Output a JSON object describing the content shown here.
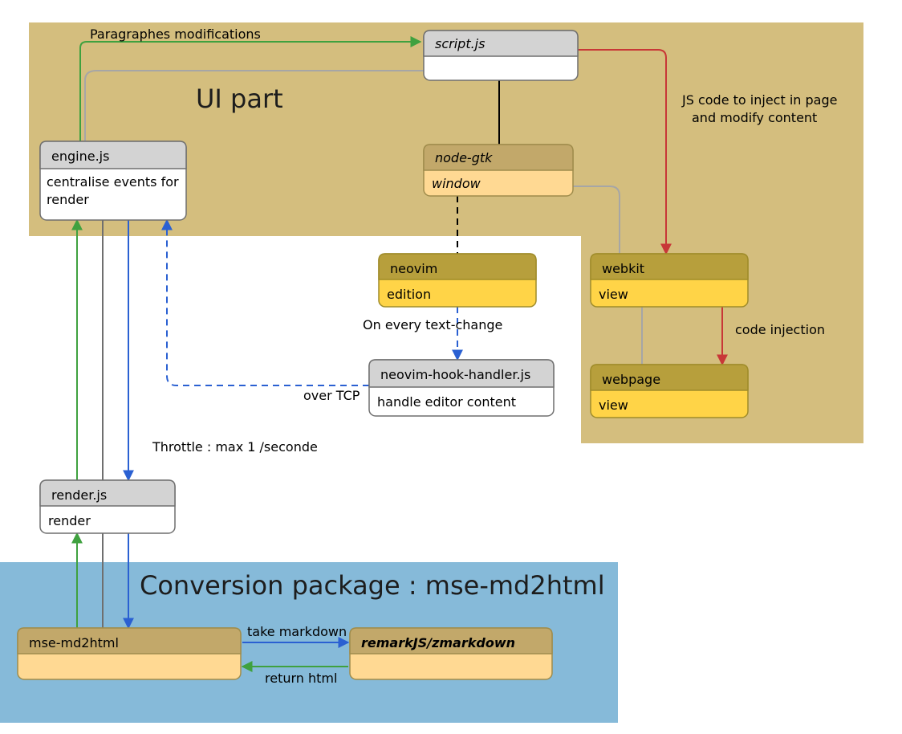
{
  "regions": {
    "ui_part": {
      "title": "UI part"
    },
    "conversion": {
      "title": "Conversion package : mse-md2html"
    }
  },
  "nodes": {
    "scriptjs": {
      "title": "script.js",
      "body": ""
    },
    "enginejs": {
      "title": "engine.js",
      "body": "centralise events for render"
    },
    "nodegtk": {
      "title": "node-gtk",
      "body": "window"
    },
    "neovim": {
      "title": "neovim",
      "body": "edition"
    },
    "webkit": {
      "title": "webkit",
      "body": "view"
    },
    "hook": {
      "title": "neovim-hook-handler.js",
      "body": "handle editor content"
    },
    "webpage": {
      "title": "webpage",
      "body": "view"
    },
    "renderjs": {
      "title": "render.js",
      "body": "render"
    },
    "msemd2html": {
      "title": "mse-md2html",
      "body": ""
    },
    "remarkjs": {
      "title": "remarkJS/zmarkdown",
      "body": ""
    }
  },
  "edges": {
    "paragraphes": "Paragraphes modifications",
    "jsinject1": "JS code to inject in page",
    "jsinject2": "and modify content",
    "textchange": "On every text-change",
    "overtcp": "over TCP",
    "codeinj": "code injection",
    "throttle": "Throttle : max 1 /seconde",
    "takemd": "take markdown",
    "returnhtml": "return html"
  }
}
